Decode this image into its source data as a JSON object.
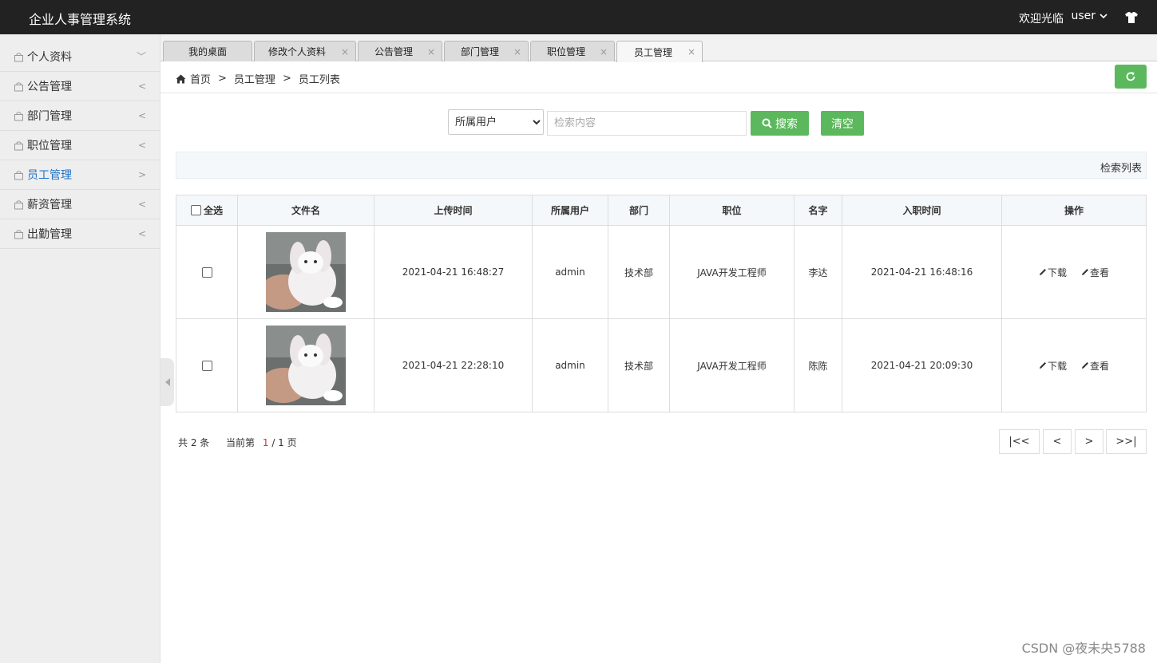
{
  "header": {
    "title": "企业人事管理系统",
    "welcome": "欢迎光临",
    "user": "user"
  },
  "sidebar": {
    "items": [
      {
        "label": "个人资料",
        "arrow": "﹀"
      },
      {
        "label": "公告管理",
        "arrow": "<"
      },
      {
        "label": "部门管理",
        "arrow": "<"
      },
      {
        "label": "职位管理",
        "arrow": "<"
      },
      {
        "label": "员工管理",
        "arrow": ">"
      },
      {
        "label": "薪资管理",
        "arrow": "<"
      },
      {
        "label": "出勤管理",
        "arrow": "<"
      }
    ],
    "active_index": 4
  },
  "tabs": [
    {
      "label": "我的桌面",
      "close": ""
    },
    {
      "label": "修改个人资料",
      "close": "×"
    },
    {
      "label": "公告管理",
      "close": "×"
    },
    {
      "label": "部门管理",
      "close": "×"
    },
    {
      "label": "职位管理",
      "close": "×"
    },
    {
      "label": "员工管理",
      "close": "×"
    }
  ],
  "breadcrumb": {
    "home": "首页",
    "sep": ">",
    "level1": "员工管理",
    "level2": "员工列表"
  },
  "search": {
    "select_value": "所属用户",
    "placeholder": "检索内容",
    "search_label": "搜索",
    "clear_label": "清空"
  },
  "list_title": "检索列表",
  "table": {
    "select_all": "全选",
    "columns": [
      "文件名",
      "上传时间",
      "所属用户",
      "部门",
      "职位",
      "名字",
      "入职时间",
      "操作"
    ],
    "rows": [
      {
        "upload_time": "2021-04-21 16:48:27",
        "user": "admin",
        "dept": "技术部",
        "position": "JAVA开发工程师",
        "name": "李达",
        "hire_time": "2021-04-21 16:48:16"
      },
      {
        "upload_time": "2021-04-21 22:28:10",
        "user": "admin",
        "dept": "技术部",
        "position": "JAVA开发工程师",
        "name": "陈陈",
        "hire_time": "2021-04-21 20:09:30"
      }
    ],
    "op_download": "下载",
    "op_view": "查看"
  },
  "pager": {
    "total": "共 2 条",
    "current_prefix": "当前第",
    "current": "1",
    "total_pages": "/ 1 页",
    "first": "|<<",
    "prev": "<",
    "next": ">",
    "last": ">>|"
  },
  "watermark": "CSDN @夜未央5788",
  "colors": {
    "header_bg": "#222222",
    "accent_green": "#5cb85c",
    "active_link": "#2273c4",
    "current_page": "#d9322f"
  }
}
